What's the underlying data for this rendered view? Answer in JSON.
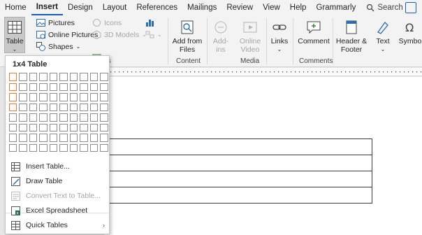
{
  "tabs": [
    "Home",
    "Insert",
    "Design",
    "Layout",
    "References",
    "Mailings",
    "Review",
    "View",
    "Help",
    "Grammarly"
  ],
  "active_tab": "Insert",
  "search_label": "Search",
  "ribbon": {
    "table": "Table",
    "pictures": "Pictures",
    "online_pictures": "Online Pictures",
    "shapes": "Shapes",
    "icons": "Icons",
    "models_3d": "3D Models",
    "add_from_files_line1": "Add from",
    "add_from_files_line2": "Files",
    "add_ins_line1": "Add-",
    "add_ins_line2": "ins",
    "online_video_line1": "Online",
    "online_video_line2": "Video",
    "links": "Links",
    "comment": "Comment",
    "header_footer_line1": "Header &",
    "header_footer_line2": "Footer",
    "text": "Text",
    "symbols": "Symbo",
    "groups": {
      "illustrations_partial": "ns",
      "content": "Content",
      "media": "Media",
      "comments": "Comments"
    }
  },
  "dropdown": {
    "title": "1x4 Table",
    "grid_cols": 10,
    "grid_rows": 8,
    "selected_cols": 1,
    "selected_rows": 4,
    "items": [
      {
        "label": "Insert Table...",
        "icon": "insert-table-icon",
        "disabled": false
      },
      {
        "label": "Draw Table",
        "icon": "draw-table-icon",
        "disabled": false
      },
      {
        "label": "Convert Text to Table...",
        "icon": "convert-text-icon",
        "disabled": true
      },
      {
        "label": "Excel Spreadsheet",
        "icon": "excel-icon",
        "disabled": false
      },
      {
        "label": "Quick Tables",
        "icon": "quick-tables-icon",
        "disabled": false,
        "submenu": true
      }
    ]
  },
  "document_table": {
    "rows": 4,
    "cols": 1
  }
}
